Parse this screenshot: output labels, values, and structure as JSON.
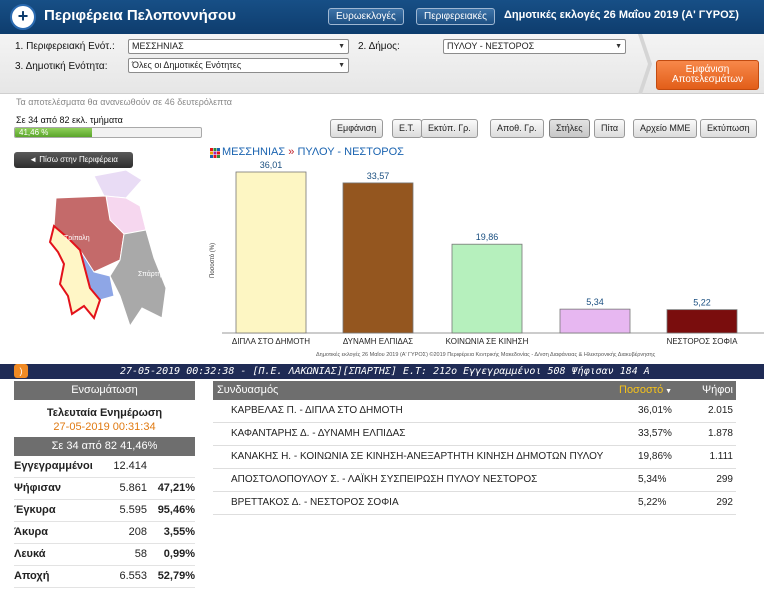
{
  "header": {
    "logo_glyph": "+",
    "title": "Περιφέρεια Πελοποννήσου",
    "btn_euro": "Ευρωεκλογές",
    "btn_regional": "Περιφερειακές",
    "election_title": "Δημοτικές εκλογές 26 Μαΐου 2019 (Α' ΓΥΡΟΣ)"
  },
  "filters": {
    "label1": "1. Περιφερειακή Ενότ.:",
    "value1": "ΜΕΣΣΗΝΙΑΣ",
    "label2": "2. Δήμος:",
    "value2": "ΠΥΛΟΥ - ΝΕΣΤΟΡΟΣ",
    "label3": "3. Δημοτική Ενότητα:",
    "value3": "Όλες οι Δημοτικές Ενότητες",
    "show_results_line1": "Εμφάνιση",
    "show_results_line2": "Αποτελεσμάτων"
  },
  "refresh_note": "Τα αποτελέσματα θα ανανεωθούν σε 46 δευτερόλεπτα",
  "counting": {
    "label": "Σε 34 από 82 εκλ. τμήματα",
    "percent_text": "41,46 %",
    "fraction": 0.4146
  },
  "view_buttons": [
    "Εμφάνιση",
    "Ε.Τ.",
    "Εκτύπ. Γρ.",
    "Αποθ. Γρ.",
    "Στήλες",
    "Πίτα",
    "Αρχείο ΜΜΕ",
    "Εκτύπωση"
  ],
  "active_view": "Στήλες",
  "back_button": "◄ Πίσω στην Περιφέρεια",
  "map": {
    "label_tripoli": "Τρίπολη",
    "label_sparti": "Σπάρτη"
  },
  "breadcrumb": {
    "region": "ΜΕΣΣΗΝΙΑΣ",
    "sep": "»",
    "municipality": "ΠΥΛΟΥ - ΝΕΣΤΟΡΟΣ"
  },
  "chart_data": {
    "type": "bar",
    "categories": [
      "ΔΙΠΛΑ ΣΤΟ ΔΗΜΟΤΗ",
      "ΔΥΝΑΜΗ ΕΛΠΙΔΑΣ",
      "ΚΟΙΝΩΝΙΑ ΣΕ ΚΙΝΗΣΗ",
      "ΛΑΪΚΗ ΣΥΣΠΕΙΡΩΣΗ ΠΥΛΟΥ ΝΕΣΤΟΡΟΣ",
      "ΝΕΣΤΟΡΟΣ ΣΟΦΙΑ"
    ],
    "value_labels": [
      "36,01",
      "33,57",
      "19,86",
      "5,34",
      "5,22"
    ],
    "values": [
      36.01,
      33.57,
      19.86,
      5.34,
      5.22
    ],
    "colors": [
      "#fdf6c3",
      "#94561f",
      "#b6f0bd",
      "#e7b7f1",
      "#7a0d0d"
    ],
    "ylabel": "Ποσοστό (%)",
    "ylim": [
      0,
      36.01
    ],
    "footnote": "Δημοτικές εκλογές 26 Μαΐου 2019 (Α' ΓΥΡΟΣ) ©2019 Περιφέρεια Κεντρικής Μακεδονίας - Δ/νση Διαφάνειας & Ηλεκτρονικής Διακυβέρνησης"
  },
  "ticker": {
    "text": "27-05-2019 00:32:38 - [Π.Ε. ΛΑΚΩΝΙΑΣ][ΣΠΑΡΤΗΣ] Ε.Τ: 212ο Εγγεγραμμένοι 508 Ψήφισαν 184 Α"
  },
  "summary": {
    "title": "Ενσωμάτωση",
    "last_update_label": "Τελευταία Ενημέρωση",
    "last_update_time": "27-05-2019 00:31:34",
    "count_text": "Σε 34 από 82 41,46%",
    "rows": [
      {
        "label": "Εγγεγραμμένοι",
        "value": "12.414",
        "pct": ""
      },
      {
        "label": "Ψήφισαν",
        "value": "5.861",
        "pct": "47,21%"
      },
      {
        "label": "Έγκυρα",
        "value": "5.595",
        "pct": "95,46%"
      },
      {
        "label": "Άκυρα",
        "value": "208",
        "pct": "3,55%"
      },
      {
        "label": "Λευκά",
        "value": "58",
        "pct": "0,99%"
      },
      {
        "label": "Αποχή",
        "value": "6.553",
        "pct": "52,79%"
      }
    ]
  },
  "results": {
    "col_combination": "Συνδυασμός",
    "col_percent": "Ποσοστό",
    "col_votes": "Ψήφοι",
    "rows": [
      {
        "name": "ΚΑΡΒΕΛΑΣ Π. - ΔΙΠΛΑ ΣΤΟ ΔΗΜΟΤΗ",
        "pct": "36,01%",
        "votes": "2.015"
      },
      {
        "name": "ΚΑΦΑΝΤΑΡΗΣ Δ. - ΔΥΝΑΜΗ ΕΛΠΙΔΑΣ",
        "pct": "33,57%",
        "votes": "1.878"
      },
      {
        "name": "ΚΑΝΑΚΗΣ Η. - ΚΟΙΝΩΝΙΑ ΣΕ ΚΙΝΗΣΗ-ΑΝΕΞΑΡΤΗΤΗ ΚΙΝΗΣΗ ΔΗΜΟΤΩΝ ΠΥΛΟΥ",
        "pct": "19,86%",
        "votes": "1.111"
      },
      {
        "name": "ΑΠΟΣΤΟΛΟΠΟΥΛΟΥ Σ. - ΛΑΪΚΗ ΣΥΣΠΕΙΡΩΣΗ ΠΥΛΟΥ ΝΕΣΤΟΡΟΣ",
        "pct": "5,34%",
        "votes": "299"
      },
      {
        "name": "ΒΡΕΤΤΑΚΟΣ Δ. - ΝΕΣΤΟΡΟΣ ΣΟΦΙΑ",
        "pct": "5,22%",
        "votes": "292"
      }
    ]
  }
}
